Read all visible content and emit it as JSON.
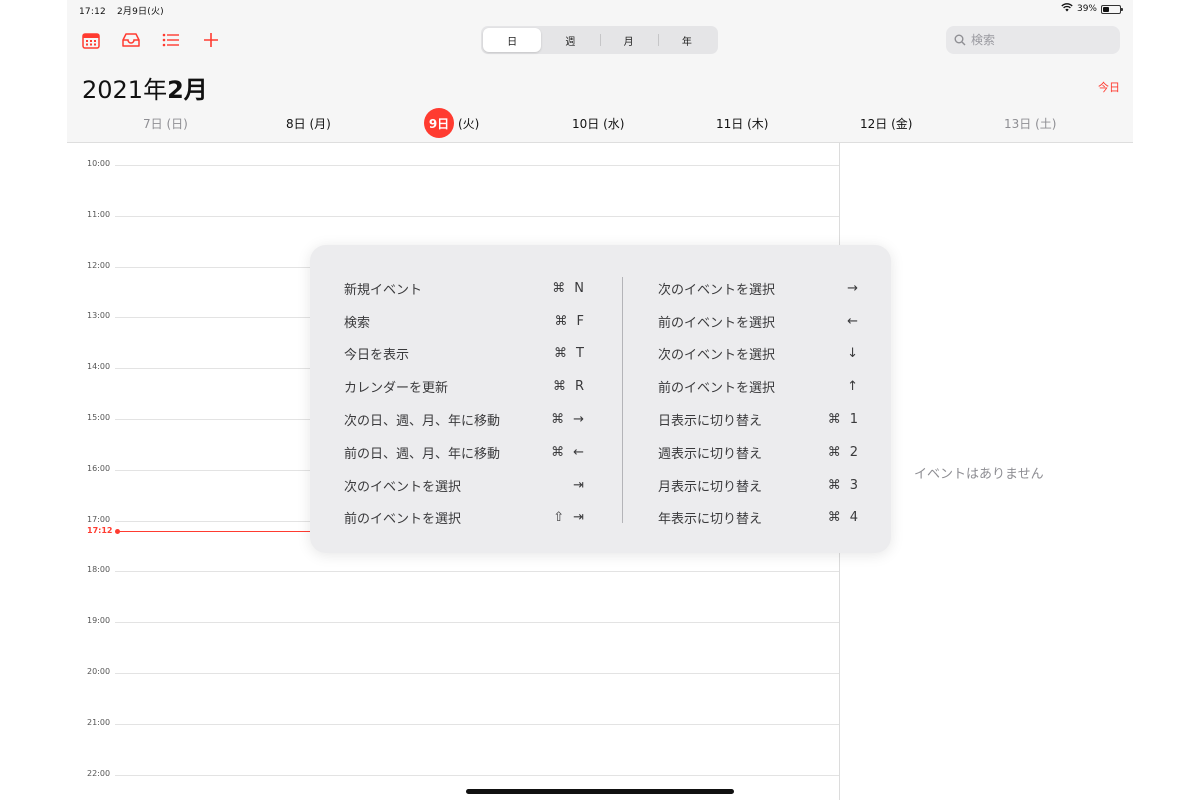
{
  "status_bar": {
    "time": "17:12",
    "date": "2月9日(火)",
    "battery": "39%",
    "battery_level": 0.39
  },
  "toolbar": {
    "icons": [
      "calendar-icon",
      "inbox-icon",
      "list-icon",
      "plus-icon"
    ],
    "accent": "#ff3b30",
    "view_tabs": [
      {
        "label": "日",
        "active": true
      },
      {
        "label": "週",
        "active": false
      },
      {
        "label": "月",
        "active": false
      },
      {
        "label": "年",
        "active": false
      }
    ],
    "search_placeholder": "検索"
  },
  "header": {
    "year_label": "2021年",
    "month_label": "2月",
    "today_button": "今日"
  },
  "days": [
    {
      "num": "7日",
      "dow": "(日)",
      "weekend": true,
      "selected": false
    },
    {
      "num": "8日",
      "dow": "(月)",
      "weekend": false,
      "selected": false
    },
    {
      "num": "9日",
      "dow": "(火)",
      "weekend": false,
      "selected": true
    },
    {
      "num": "10日",
      "dow": "(水)",
      "weekend": false,
      "selected": false
    },
    {
      "num": "11日",
      "dow": "(木)",
      "weekend": false,
      "selected": false
    },
    {
      "num": "12日",
      "dow": "(金)",
      "weekend": false,
      "selected": false
    },
    {
      "num": "13日",
      "dow": "(土)",
      "weekend": true,
      "selected": false
    }
  ],
  "timeline": {
    "hours": [
      "10:00",
      "11:00",
      "12:00",
      "13:00",
      "14:00",
      "15:00",
      "16:00",
      "17:00",
      "18:00",
      "19:00",
      "20:00",
      "21:00",
      "22:00"
    ],
    "current_time": "17:12"
  },
  "side_panel": {
    "empty_text": "イベントはありません"
  },
  "shortcuts": {
    "left": [
      {
        "label": "新規イベント",
        "keys": [
          "⌘",
          "N"
        ]
      },
      {
        "label": "検索",
        "keys": [
          "⌘",
          "F"
        ]
      },
      {
        "label": "今日を表示",
        "keys": [
          "⌘",
          "T"
        ]
      },
      {
        "label": "カレンダーを更新",
        "keys": [
          "⌘",
          "R"
        ]
      },
      {
        "label": "次の日、週、月、年に移動",
        "keys": [
          "⌘",
          "→"
        ]
      },
      {
        "label": "前の日、週、月、年に移動",
        "keys": [
          "⌘",
          "←"
        ]
      },
      {
        "label": "次のイベントを選択",
        "keys": [
          "⇥"
        ]
      },
      {
        "label": "前のイベントを選択",
        "keys": [
          "⇧",
          "⇥"
        ]
      }
    ],
    "right": [
      {
        "label": "次のイベントを選択",
        "keys": [
          "→"
        ]
      },
      {
        "label": "前のイベントを選択",
        "keys": [
          "←"
        ]
      },
      {
        "label": "次のイベントを選択",
        "keys": [
          "↓"
        ]
      },
      {
        "label": "前のイベントを選択",
        "keys": [
          "↑"
        ]
      },
      {
        "label": "日表示に切り替え",
        "keys": [
          "⌘",
          "1"
        ]
      },
      {
        "label": "週表示に切り替え",
        "keys": [
          "⌘",
          "2"
        ]
      },
      {
        "label": "月表示に切り替え",
        "keys": [
          "⌘",
          "3"
        ]
      },
      {
        "label": "年表示に切り替え",
        "keys": [
          "⌘",
          "4"
        ]
      }
    ]
  }
}
